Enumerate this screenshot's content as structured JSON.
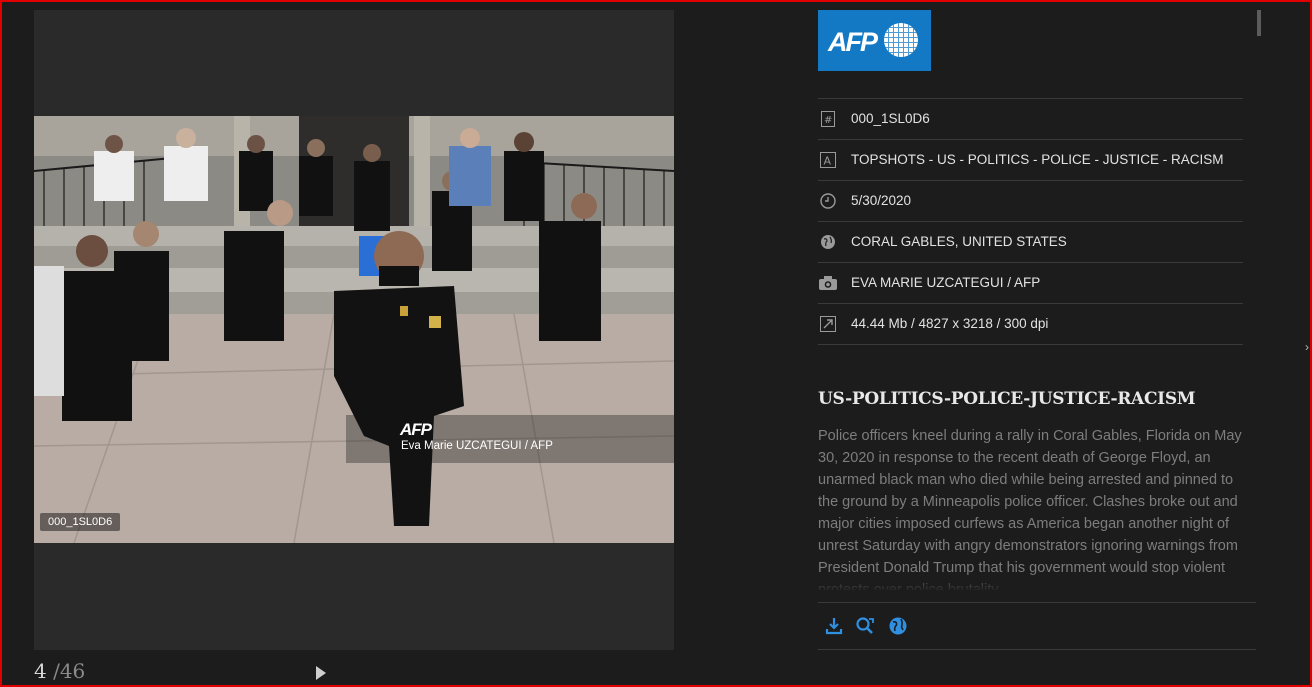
{
  "viewer": {
    "photo_label": "000_1SL0D6",
    "watermark_logo": "AFP",
    "watermark_credit": "Eva Marie UZCATEGUI / AFP",
    "pager_current": "4",
    "pager_total": "/46"
  },
  "logo": {
    "text": "AFP"
  },
  "meta": {
    "id": "000_1SL0D6",
    "title": "TOPSHOTS - US - POLITICS - POLICE - JUSTICE - RACISM",
    "date": "5/30/2020",
    "location": "CORAL GABLES, UNITED STATES",
    "photographer": "EVA MARIE UZCATEGUI / AFP",
    "size": "44.44 Mb / 4827 x 3218 / 300 dpi"
  },
  "headline": "US-POLITICS-POLICE-JUSTICE-RACISM",
  "caption": "Police officers kneel during a rally in Coral Gables, Florida on May 30, 2020 in response to the recent death of George Floyd, an unarmed black man who died while being arrested and pinned to the ground by a Minneapolis police officer. Clashes broke out and major cities imposed curfews as America began another night of unrest Saturday with angry demonstrators ignoring warnings from President Donald Trump that his government would stop violent protests over police brutality.",
  "colors": {
    "accent": "#1479c5",
    "frame": "#e00000",
    "icon_blue": "#2f8fe0"
  },
  "icons": [
    "hash-icon",
    "text-icon",
    "clock-icon",
    "globe-icon",
    "camera-icon",
    "resize-icon",
    "download-icon",
    "zoom-icon",
    "web-icon"
  ]
}
